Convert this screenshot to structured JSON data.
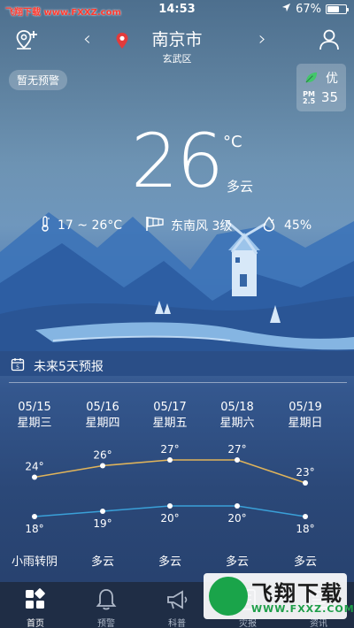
{
  "watermark": {
    "top_text": "飞翔下载 www.FXXZ.com",
    "logo_name": "飞翔下载",
    "logo_url": "WWW.FXXZ.COM"
  },
  "status_bar": {
    "time": "14:53",
    "battery": "67%",
    "battery_level": 0.67
  },
  "header": {
    "city": "南京市",
    "district": "玄武区",
    "icons": [
      "add-location-icon",
      "location-pin-icon",
      "user-profile-icon"
    ],
    "accent_color": "#e23b3b"
  },
  "alert": {
    "text": "暂无预警"
  },
  "aqi": {
    "level": "优",
    "pollutant": "PM\n2.5",
    "value": "35",
    "leaf_color": "#43c66b"
  },
  "current": {
    "temperature": "26",
    "unit": "°C",
    "condition": "多云",
    "temp_range": "17 ~ 26°C",
    "wind": "东南风 3级",
    "humidity": "45%"
  },
  "forecast": {
    "title": "未来5天预报",
    "days": [
      {
        "date": "05/15",
        "weekday": "星期三",
        "high": "24°",
        "low": "18°",
        "condition": "小雨转阴"
      },
      {
        "date": "05/16",
        "weekday": "星期四",
        "high": "26°",
        "low": "19°",
        "condition": "多云"
      },
      {
        "date": "05/17",
        "weekday": "星期五",
        "high": "27°",
        "low": "20°",
        "condition": "多云"
      },
      {
        "date": "05/18",
        "weekday": "星期六",
        "high": "27°",
        "low": "20°",
        "condition": "多云"
      },
      {
        "date": "05/19",
        "weekday": "星期日",
        "high": "23°",
        "low": "18°",
        "condition": "多云"
      }
    ],
    "high_values": [
      24,
      26,
      27,
      27,
      23
    ],
    "low_values": [
      18,
      19,
      20,
      20,
      18
    ],
    "high_color": "#e0b45a",
    "low_color": "#3aa0d8"
  },
  "tabs": [
    {
      "label": "首页",
      "icon": "home-grid-icon"
    },
    {
      "label": "预警",
      "icon": "bell-icon"
    },
    {
      "label": "科普",
      "icon": "megaphone-icon"
    },
    {
      "label": "灾报",
      "icon": "report-icon"
    },
    {
      "label": "资讯",
      "icon": "news-icon"
    }
  ]
}
